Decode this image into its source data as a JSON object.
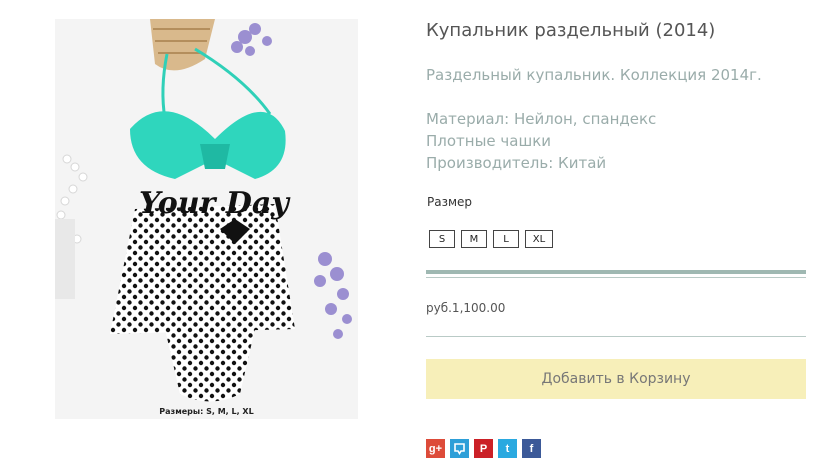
{
  "product": {
    "title": "Купальник раздельный (2014)",
    "image_caption": "Размеры: S, M, L, XL",
    "image_text": "Your Day",
    "description": [
      "Раздельный купальник. Коллекция 2014г.",
      "Материал: Нейлон, спандекс",
      "Плотные чашки",
      "Производитель: Китай"
    ],
    "size_label": "Размер",
    "sizes": [
      "S",
      "M",
      "L",
      "XL"
    ],
    "price": "руб.1,100.00",
    "add_to_cart_label": "Добавить в Корзину"
  },
  "share": {
    "icons": [
      {
        "name": "google-plus-icon",
        "glyph": "g+",
        "color": "#dd4b39"
      },
      {
        "name": "moikrug-icon",
        "glyph": "",
        "color": "#2d9fd8"
      },
      {
        "name": "pinterest-icon",
        "glyph": "P",
        "color": "#cb2027"
      },
      {
        "name": "twitter-icon",
        "glyph": "t",
        "color": "#2aa9e0"
      },
      {
        "name": "facebook-icon",
        "glyph": "f",
        "color": "#3b5998"
      }
    ]
  }
}
